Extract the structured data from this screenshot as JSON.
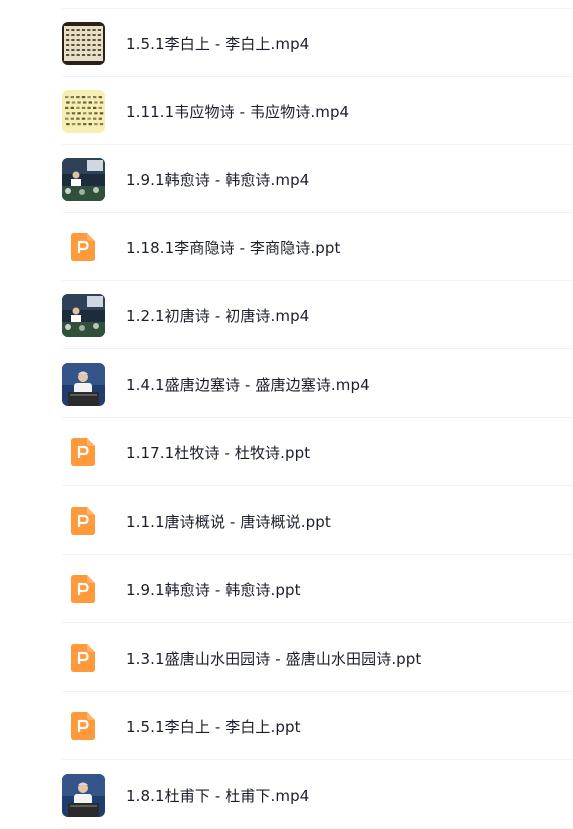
{
  "files": [
    {
      "name": "1.5.1李白上 - 李白上.mp4",
      "type": "video",
      "thumb": "calligraphy-dark"
    },
    {
      "name": "1.11.1韦应物诗 - 韦应物诗.mp4",
      "type": "video",
      "thumb": "calligraphy-yellow"
    },
    {
      "name": "1.9.1韩愈诗 - 韩愈诗.mp4",
      "type": "video",
      "thumb": "lecture-hall"
    },
    {
      "name": "1.18.1李商隐诗 - 李商隐诗.ppt",
      "type": "ppt"
    },
    {
      "name": "1.2.1初唐诗 - 初唐诗.mp4",
      "type": "video",
      "thumb": "lecture-hall"
    },
    {
      "name": "1.4.1盛唐边塞诗 - 盛唐边塞诗.mp4",
      "type": "video",
      "thumb": "lecturer-podium"
    },
    {
      "name": "1.17.1杜牧诗 - 杜牧诗.ppt",
      "type": "ppt"
    },
    {
      "name": "1.1.1唐诗概说 - 唐诗概说.ppt",
      "type": "ppt"
    },
    {
      "name": "1.9.1韩愈诗 - 韩愈诗.ppt",
      "type": "ppt"
    },
    {
      "name": "1.3.1盛唐山水田园诗 - 盛唐山水田园诗.ppt",
      "type": "ppt"
    },
    {
      "name": "1.5.1李白上 - 李白上.ppt",
      "type": "ppt"
    },
    {
      "name": "1.8.1杜甫下 - 杜甫下.mp4",
      "type": "video",
      "thumb": "lecturer-podium"
    }
  ],
  "colors": {
    "ppt_icon": "#ff9a3c",
    "ppt_icon_light": "#ffb467",
    "text": "#1c1f2b",
    "divider": "#f1f2f4"
  }
}
